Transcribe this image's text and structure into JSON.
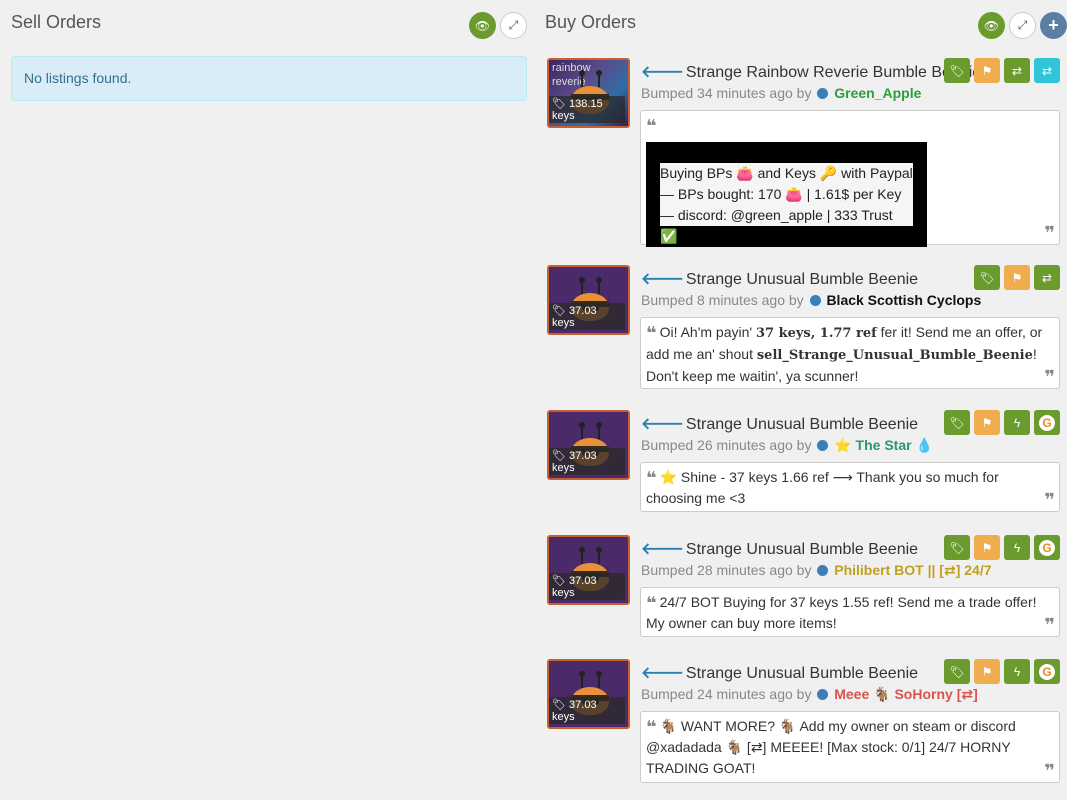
{
  "sell": {
    "title": "Sell Orders",
    "empty_text": "No listings found."
  },
  "buy": {
    "title": "Buy Orders",
    "listings": [
      {
        "title": "Strange Rainbow Reverie Bumble Beenie",
        "effect": "rainbow reverie",
        "price": "138.15 keys",
        "bumped": "Bumped 34 minutes ago by",
        "user": "Green_Apple",
        "comment_lines": [
          "Buying BPs 👛 and Keys 🔑 with Paypal",
          "— BPs bought: 170 👛 | 1.61$ per Key",
          "— discord: @green_apple | 333 Trust ✅"
        ]
      },
      {
        "title": "Strange Unusual Bumble Beenie",
        "price": "37.03 keys",
        "bumped": "Bumped 8 minutes ago by",
        "user": "Black Scottish Cyclops",
        "comment_a": "Oi! Ah'm payin' ",
        "comment_b": "37 keys, 1.77 ref",
        "comment_c": " fer it! Send me an offer, or add me an' shout ",
        "comment_d": "sell_Strange_Unusual_Bumble_Beenie",
        "comment_e": "! Don't keep me waitin', ya scunner!"
      },
      {
        "title": "Strange Unusual Bumble Beenie",
        "price": "37.03 keys",
        "bumped": "Bumped 26 minutes ago by",
        "user": "⭐ The Star 💧",
        "comment": "⭐ Shine - 37 keys 1.66 ref ⟶ Thank you so much for choosing me <3"
      },
      {
        "title": "Strange Unusual Bumble Beenie",
        "price": "37.03 keys",
        "bumped": "Bumped 28 minutes ago by",
        "user": "Philibert BOT || [⇄] 24/7",
        "comment": "24/7 BOT Buying for 37 keys 1.55 ref! Send me a trade offer! My owner can buy more items!"
      },
      {
        "title": "Strange Unusual Bumble Beenie",
        "price": "37.03 keys",
        "bumped": "Bumped 24 minutes ago by",
        "user": "Meee 🐐 SoHorny [⇄]",
        "comment": "🐐 WANT MORE? 🐐 Add my owner on steam or discord @xadadada 🐐 [⇄] MEEEE! [Max stock: 0/1] 24/7 HORNY TRADING GOAT!"
      }
    ]
  },
  "colors": {
    "accent_green": "#6b9a2f",
    "accent_orange": "#f0ad4e",
    "accent_cyan": "#2fc4d6",
    "info_bg": "#d9edf7"
  }
}
